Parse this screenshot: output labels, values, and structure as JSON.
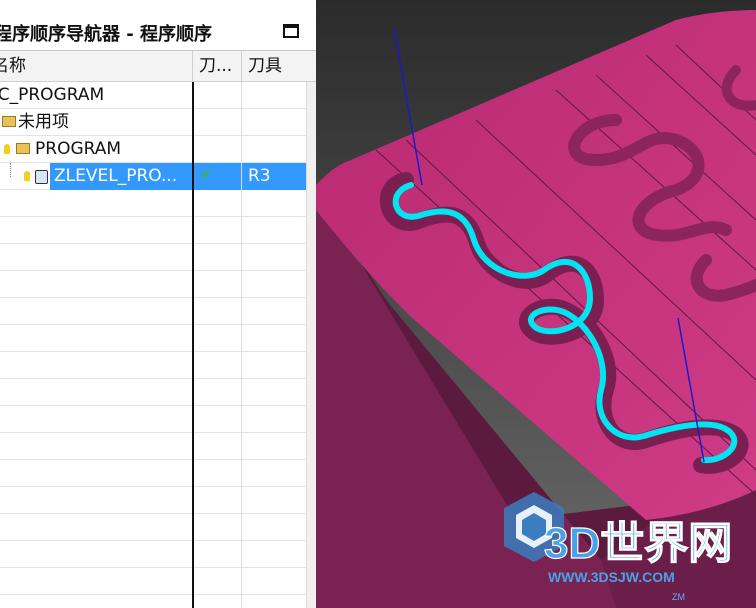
{
  "navigator": {
    "title": "程序顺序导航器 - 程序顺序",
    "columns": {
      "name": "名称",
      "tool_changes": "刀...",
      "tool": "刀具"
    },
    "rows": [
      {
        "name": "NC_PROGRAM",
        "tool_change": "",
        "tool": ""
      },
      {
        "name": "未用项",
        "tool_change": "",
        "tool": ""
      },
      {
        "name": "PROGRAM",
        "tool_change": "",
        "tool": ""
      },
      {
        "name": "ZLEVEL_PRO...",
        "tool_change": "✔",
        "tool": "R3"
      }
    ],
    "selected_row": 3
  },
  "viewport": {
    "watermark_text": "3D世界网",
    "watermark_url": "WWW.3DSJW.COM",
    "axis_label": "ZM",
    "colors": {
      "part_top": "#c8327e",
      "part_side": "#6e1f4b",
      "toolpath": "#00e5f0",
      "tool_axis": "#1a1acc",
      "background_top": "#2b2b2b",
      "background_bottom": "#6a6a6a"
    }
  }
}
